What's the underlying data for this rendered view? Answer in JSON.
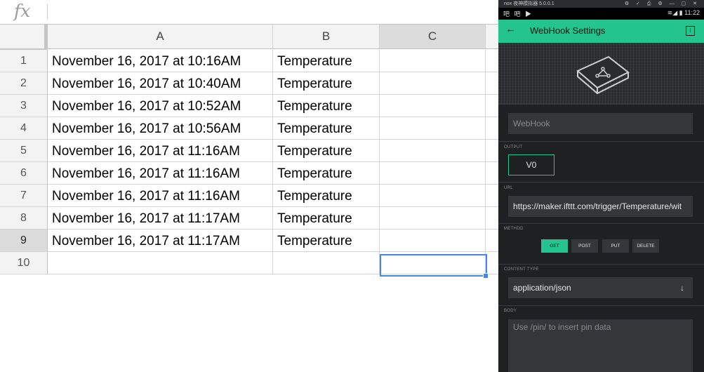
{
  "formula_bar": {
    "fx_label": "fx",
    "value": ""
  },
  "sheet": {
    "columns": [
      "A",
      "B",
      "C"
    ],
    "rows": [
      {
        "num": "1",
        "a": "November 16, 2017 at 10:16AM",
        "b": "Temperature",
        "c": ""
      },
      {
        "num": "2",
        "a": "November 16, 2017 at 10:40AM",
        "b": "Temperature",
        "c": ""
      },
      {
        "num": "3",
        "a": "November 16, 2017 at 10:52AM",
        "b": "Temperature",
        "c": ""
      },
      {
        "num": "4",
        "a": "November 16, 2017 at 10:56AM",
        "b": "Temperature",
        "c": ""
      },
      {
        "num": "5",
        "a": "November 16, 2017 at 11:16AM",
        "b": "Temperature",
        "c": ""
      },
      {
        "num": "6",
        "a": "November 16, 2017 at 11:16AM",
        "b": "Temperature",
        "c": ""
      },
      {
        "num": "7",
        "a": "November 16, 2017 at 11:16AM",
        "b": "Temperature",
        "c": ""
      },
      {
        "num": "8",
        "a": "November 16, 2017 at 11:17AM",
        "b": "Temperature",
        "c": ""
      },
      {
        "num": "9",
        "a": "November 16, 2017 at 11:17AM",
        "b": "Temperature",
        "c": ""
      },
      {
        "num": "10",
        "a": "",
        "b": "",
        "c": ""
      }
    ],
    "selected_cell": "C9"
  },
  "emulator": {
    "title": "nox 夜神模拟器 5.0.0.1",
    "controls": "⚙ ✓ ⎙ ⚙ — ▢ ✕",
    "status_left": "吧 吧 ▶",
    "status_right": "≋◢ ▮ 11:22"
  },
  "app": {
    "back_icon": "arrow-left-icon",
    "title": "WebHook Settings",
    "info_label": "i",
    "name_value": "WebHook",
    "output_label": "OUTPUT",
    "output_value": "V0",
    "url_label": "URL",
    "url_value": "https://maker.ifttt.com/trigger/Temperature/wit",
    "method_label": "METHOD",
    "methods": [
      "GET",
      "POST",
      "PUT",
      "DELETE"
    ],
    "active_method": "GET",
    "content_type_label": "CONTENT TYPE",
    "content_type_value": "application/json",
    "body_label": "BODY",
    "body_placeholder": "Use /pin/ to insert pin data",
    "accent_color": "#23c48e"
  }
}
